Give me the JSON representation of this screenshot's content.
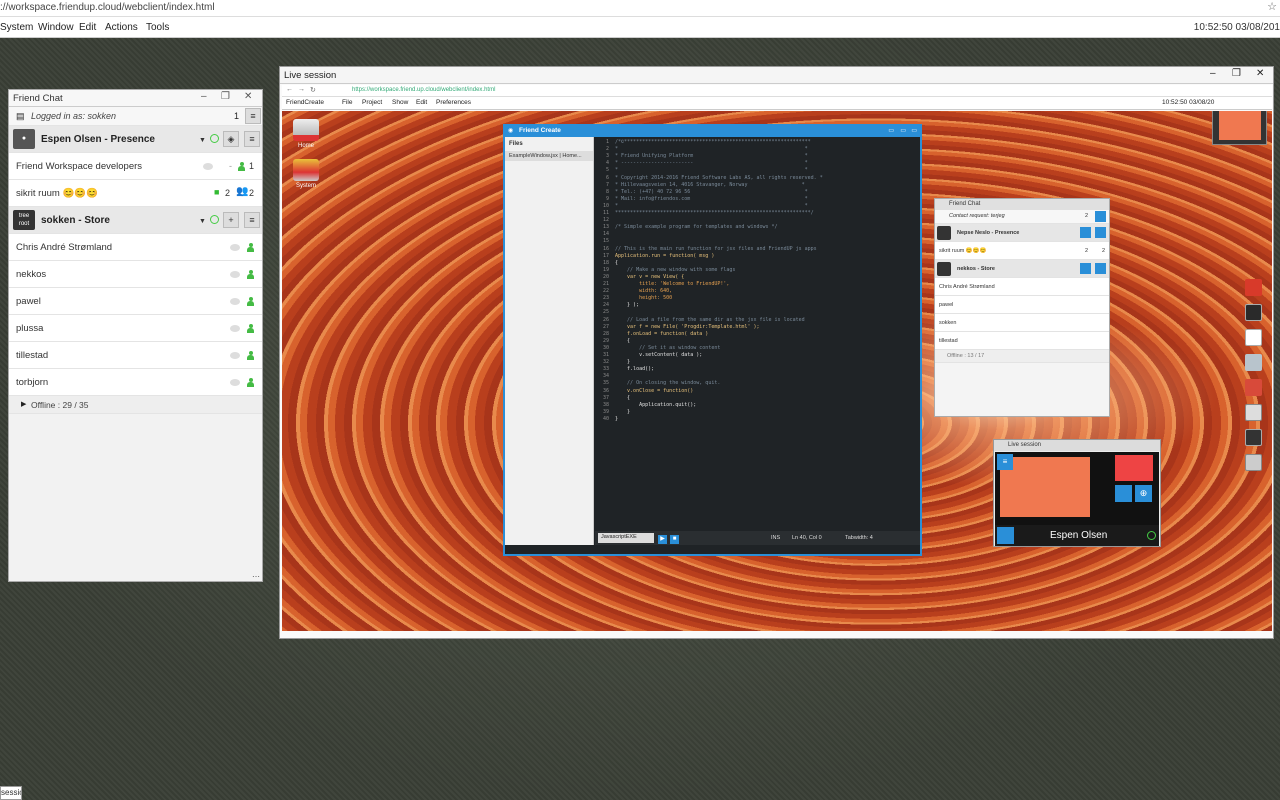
{
  "browser": {
    "url": "://workspace.friendup.cloud/webclient/index.html"
  },
  "menubar": {
    "items": [
      "System",
      "Window",
      "Edit",
      "Actions",
      "Tools"
    ],
    "clock": "10:52:50 03/08/201"
  },
  "chat": {
    "title": "Friend Chat",
    "logged_in": "Logged in as: sokken",
    "logged_count": "1",
    "account_name": "Espen Olsen - Presence",
    "rooms": [
      {
        "name": "Friend Workspace developers",
        "count": "1"
      },
      {
        "name": "sikrit ruum 😊😊😊",
        "video": "2",
        "people": "2"
      }
    ],
    "store_name": "sokken - Store",
    "store_avatar_text": "tree root",
    "contacts": [
      "Chris André Strømland",
      "nekkos",
      "pawel",
      "plussa",
      "tillestad",
      "torbjorn"
    ],
    "offline": "Offline : 29 / 35"
  },
  "live": {
    "title": "Live session",
    "inner_url": "https://workspace.friend.up.cloud/webclient/index.html",
    "inner_menu": [
      "FriendCreate",
      "File",
      "Project",
      "Show",
      "Edit",
      "Preferences"
    ],
    "inner_clock": "10:52:50 03/08/20",
    "desktop_icons": [
      "Home",
      "System"
    ]
  },
  "editor": {
    "title": "Friend Create",
    "files_header": "Files",
    "file_item": "ExampleWindow.jsx | Home...",
    "language": "JavascriptEXE",
    "mode": "INS",
    "position": "Ln 40, Col 0",
    "tabwidth": "Tabwidth: 4",
    "lines": [
      {
        "n": "1",
        "c": "cm",
        "t": "/*©**************************************************************"
      },
      {
        "n": "2",
        "c": "cm",
        "t": "*                                                              *"
      },
      {
        "n": "3",
        "c": "cm",
        "t": "* Friend Unifying Platform                                     *"
      },
      {
        "n": "4",
        "c": "cm",
        "t": "* ------------------------                                     *"
      },
      {
        "n": "5",
        "c": "cm",
        "t": "*                                                              *"
      },
      {
        "n": "6",
        "c": "cm",
        "t": "* Copyright 2014-2016 Friend Software Labs AS, all rights reserved. *"
      },
      {
        "n": "7",
        "c": "cm",
        "t": "* Hillevaagsveien 14, 4016 Stavanger, Norway                  *"
      },
      {
        "n": "8",
        "c": "cm",
        "t": "* Tel.: (+47) 40 72 96 56                                      *"
      },
      {
        "n": "9",
        "c": "cm",
        "t": "* Mail: info@friendos.com                                      *"
      },
      {
        "n": "10",
        "c": "cm",
        "t": "*                                                              *"
      },
      {
        "n": "11",
        "c": "cm",
        "t": "*****************************************************************/"
      },
      {
        "n": "12",
        "c": "tx",
        "t": ""
      },
      {
        "n": "13",
        "c": "cm",
        "t": "/* Simple example program for templates and windows */"
      },
      {
        "n": "14",
        "c": "tx",
        "t": ""
      },
      {
        "n": "15",
        "c": "tx",
        "t": ""
      },
      {
        "n": "16",
        "c": "cm",
        "t": "// This is the main run function for jsx files and FriendUP js apps"
      },
      {
        "n": "17",
        "c": "kw",
        "t": "Application.run = function( msg )"
      },
      {
        "n": "18",
        "c": "tx",
        "t": "{"
      },
      {
        "n": "19",
        "c": "cm",
        "t": "    // Make a new window with some flags"
      },
      {
        "n": "20",
        "c": "kw",
        "t": "    var v = new View( {"
      },
      {
        "n": "21",
        "c": "st",
        "t": "        title: 'Welcome to FriendUP!',"
      },
      {
        "n": "22",
        "c": "st",
        "t": "        width: 640,"
      },
      {
        "n": "23",
        "c": "st",
        "t": "        height: 500"
      },
      {
        "n": "24",
        "c": "tx",
        "t": "    } );"
      },
      {
        "n": "25",
        "c": "tx",
        "t": ""
      },
      {
        "n": "26",
        "c": "cm",
        "t": "    // Load a file from the same dir as the jsx file is located"
      },
      {
        "n": "27",
        "c": "kw",
        "t": "    var f = new File( 'Progdir:Template.html' );"
      },
      {
        "n": "28",
        "c": "kw",
        "t": "    f.onLoad = function( data )"
      },
      {
        "n": "29",
        "c": "tx",
        "t": "    {"
      },
      {
        "n": "30",
        "c": "cm",
        "t": "        // Set it as window content"
      },
      {
        "n": "31",
        "c": "tx",
        "t": "        v.setContent( data );"
      },
      {
        "n": "32",
        "c": "tx",
        "t": "    }"
      },
      {
        "n": "33",
        "c": "tx",
        "t": "    f.load();"
      },
      {
        "n": "34",
        "c": "tx",
        "t": ""
      },
      {
        "n": "35",
        "c": "cm",
        "t": "    // On closing the window, quit."
      },
      {
        "n": "36",
        "c": "kw",
        "t": "    v.onClose = function()"
      },
      {
        "n": "37",
        "c": "tx",
        "t": "    {"
      },
      {
        "n": "38",
        "c": "tx",
        "t": "        Application.quit();"
      },
      {
        "n": "39",
        "c": "tx",
        "t": "    }"
      },
      {
        "n": "40",
        "c": "tx",
        "t": "}"
      }
    ]
  },
  "minichat": {
    "title": "Friend Chat",
    "contact_request": "Contact request: terjeg",
    "contact_count": "2",
    "account": "Nepse Neslo - Presence",
    "room": "sikrit ruum 😊😊😊",
    "room_video": "2",
    "room_people": "2",
    "store": "nekkos - Store",
    "contacts": [
      "Chris André Strømland",
      "pawel",
      "sokken",
      "tillestad"
    ],
    "offline": "Offline : 13 / 17"
  },
  "minilive": {
    "title": "Live session",
    "name": "Espen Olsen"
  },
  "taskbar": {
    "session_label": "session"
  },
  "colors": {
    "accent": "#2a8fd8",
    "online": "#44bb44"
  }
}
